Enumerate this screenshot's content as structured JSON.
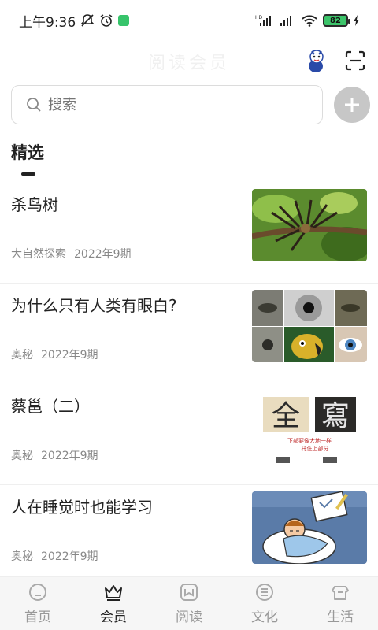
{
  "status": {
    "time": "上午9:36",
    "battery": "82",
    "network": "HD"
  },
  "header": {
    "logo_text": "阅读会员"
  },
  "search": {
    "placeholder": "搜索"
  },
  "section": {
    "title": "精选"
  },
  "articles": [
    {
      "title": "杀鸟树",
      "source": "大自然探索",
      "issue": "2022年9期",
      "thumb": "plant"
    },
    {
      "title": "为什么只有人类有眼白?",
      "source": "奥秘",
      "issue": "2022年9期",
      "thumb": "eyes"
    },
    {
      "title": "蔡邕（二）",
      "source": "奥秘",
      "issue": "2022年9期",
      "thumb": "calligraphy",
      "thumb_chars": [
        "全",
        "寫"
      ],
      "thumb_caption": "下部要像大地一样\n托住上部分"
    },
    {
      "title": "人在睡觉时也能学习",
      "source": "奥秘",
      "issue": "2022年9期",
      "thumb": "sleep"
    }
  ],
  "tabs": [
    {
      "label": "首页",
      "icon": "home-icon",
      "active": false
    },
    {
      "label": "会员",
      "icon": "crown-icon",
      "active": true
    },
    {
      "label": "阅读",
      "icon": "book-icon",
      "active": false
    },
    {
      "label": "文化",
      "icon": "culture-icon",
      "active": false
    },
    {
      "label": "生活",
      "icon": "life-icon",
      "active": false
    }
  ],
  "colors": {
    "accent": "#222222",
    "inactive": "#999999",
    "battery": "#3cc46a"
  }
}
